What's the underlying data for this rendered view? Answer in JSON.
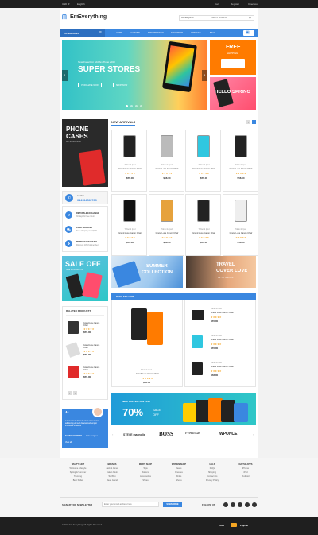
{
  "topbar": {
    "currency": "USD",
    "language": "English",
    "links": [
      "Cart",
      "Register",
      "Checkout"
    ]
  },
  "header": {
    "logo_prefix": "Em.",
    "logo_suffix": "Everything",
    "category_select": "All categories",
    "search_placeholder": "Search products"
  },
  "nav": {
    "categories": "CATEGORIES",
    "items": [
      "HOME",
      "CLOTHING",
      "SMARTPHONES",
      "FOOTWEAR",
      "WATCHES",
      "BAGS"
    ]
  },
  "slider": {
    "subtitle": "New Collection Mobile Phone 2016",
    "title": "SUPER STORES",
    "btn1": "PURCHASE NOW",
    "btn2": "SHOP NOW"
  },
  "promo_free": {
    "title": "FREE",
    "sub": "SHIPPING"
  },
  "promo_hello": {
    "title": "HELLO SPRING"
  },
  "phone_cases": {
    "title1": "PHONE",
    "title2": "CASES",
    "sub": "Win Mobile Style"
  },
  "hotline": {
    "label": "Hotline",
    "number": "012-3456-789"
  },
  "services": [
    {
      "title": "RETURN & EXCHANGE",
      "sub": "30 days for free return"
    },
    {
      "title": "FREE SHIPPING",
      "sub": "Free shipping over $100"
    },
    {
      "title": "MEMBER DISCOUNT",
      "sub": "Discount 10% for member"
    }
  ],
  "sale_off": {
    "title": "SALE OFF",
    "sub": "Sale up to 50% Off"
  },
  "related": {
    "title": "RELATED PRODUCTS",
    "items": [
      {
        "name": "Grand Luxe Canon Chair",
        "price": "$55.00"
      },
      {
        "name": "Grand Luxe Canon Chair",
        "price": "$55.00"
      },
      {
        "name": "Grand Luxe Canon Chair",
        "price": "$55.00"
      }
    ]
  },
  "testimonial": {
    "quote": "Lorem ipsum dolor sit amet consectetur adipiscing elit sed do eiusmod tempor incididunt ut labore",
    "name": "ELENA GILBERT",
    "role": "Web designer",
    "link": "View all"
  },
  "new_arrivals": {
    "title": "NEW ARRIVALS",
    "products": [
      {
        "cat": "Tablet & Ipod",
        "name": "Grand Luxe Canon Chair",
        "price": "$55.00"
      },
      {
        "cat": "Tablet & Ipod",
        "name": "Grand Luxe Canon Chair",
        "price": "$58.00"
      },
      {
        "cat": "Tablet & Ipod",
        "name": "Grand Luxe Canon Chair",
        "price": "$55.00"
      },
      {
        "cat": "Tablet & Ipod",
        "name": "Grand Luxe Canon Chair",
        "price": "$58.00"
      },
      {
        "cat": "Tablet & Ipod",
        "name": "Grand Luxe Canon Chair",
        "price": "$55.00"
      },
      {
        "cat": "Tablet & Ipod",
        "name": "Grand Luxe Canon Chair",
        "price": "$58.00"
      },
      {
        "cat": "Tablet & Ipod",
        "name": "Grand Luxe Canon Chair",
        "price": "$55.00"
      },
      {
        "cat": "Tablet & Ipod",
        "name": "Grand Luxe Canon Chair",
        "price": "$58.00"
      }
    ]
  },
  "banner_summer": {
    "title1": "SUMMER",
    "title2": "COLLECTION"
  },
  "banner_travel": {
    "title1": "TRAVEL",
    "title2": "COVER LOVE",
    "sub": "UP TO 70% OFF"
  },
  "best_sellers": {
    "title": "BEST SELLERS",
    "featured": {
      "cat": "Tablet & Ipod",
      "name": "Grand Luxe Canon Chair",
      "price": "$58.00"
    },
    "items": [
      {
        "cat": "Tablet & Ipod",
        "name": "Grand Luxe Canon Chair",
        "price": "$55.00"
      },
      {
        "cat": "Tablet & Ipod",
        "name": "Grand Luxe Canon Chair",
        "price": "$55.00"
      },
      {
        "cat": "Tablet & Ipod",
        "name": "Grand Luxe Canon Chair",
        "price": "$58.00"
      }
    ]
  },
  "collection_banner": {
    "sub": "NEW COLLECTION 2016",
    "percent": "70%",
    "sale": "SALE",
    "off": "OFF"
  },
  "brands": [
    "STEVE magnolia",
    "BOSS",
    "Freebisas",
    "WPONCE"
  ],
  "footer": {
    "columns": [
      {
        "head": "WHAT'S HOT",
        "items": [
          "Welcome Lifestyle",
          "Spring & Summer",
          "Trending",
          "Best Seller"
        ]
      },
      {
        "head": "BRANDS",
        "items": [
          "Jack & Jones",
          "Calvin Klein",
          "Ted Ben",
          "Bean Island"
        ]
      },
      {
        "head": "MEN'S SHOP",
        "items": [
          "Tops",
          "Bottoms",
          "Accessories",
          "Shoes"
        ]
      },
      {
        "head": "WOMEN SHOP",
        "items": [
          "Jeans",
          "Dresses",
          "Shirts",
          "Shoes"
        ]
      },
      {
        "head": "HELP",
        "items": [
          "FAQs",
          "Shipping",
          "Contact Us",
          "Privacy Policy"
        ]
      },
      {
        "head": "NATIVE APPS",
        "items": [
          "iPhone",
          "iPad",
          "Android"
        ]
      }
    ],
    "newsletter_label": "SIGN UP FOR NEWSLETTER",
    "newsletter_placeholder": "Enter your email address here",
    "subscribe": "SUBSCRIBE",
    "follow": "FOLLOW US"
  },
  "copyright": "© 2016 Em.Everything. All Rights Reserved.",
  "payments": [
    "VISA",
    "PayPal"
  ],
  "colors": {
    "accent": "#3a87e0",
    "orange": "#ff7b00",
    "pink": "#ff4d6d",
    "teal": "#2fc7c7"
  }
}
